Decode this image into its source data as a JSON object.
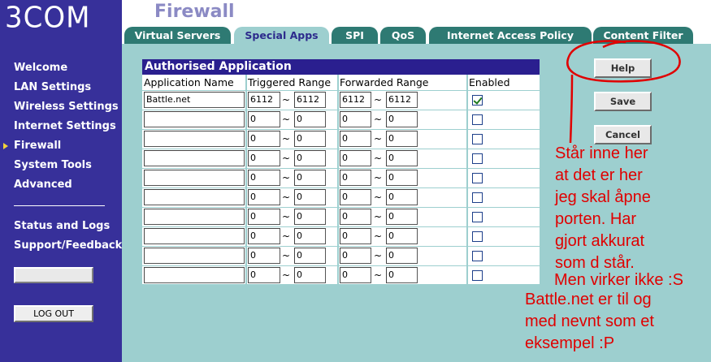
{
  "brand": {
    "logo": "3COM"
  },
  "sidebar": {
    "items": [
      {
        "label": "Welcome"
      },
      {
        "label": "LAN Settings"
      },
      {
        "label": "Wireless Settings"
      },
      {
        "label": "Internet Settings"
      },
      {
        "label": "Firewall",
        "active": true
      },
      {
        "label": "System Tools"
      },
      {
        "label": "Advanced"
      }
    ],
    "items2": [
      {
        "label": "Status and Logs"
      },
      {
        "label": "Support/Feedback"
      }
    ],
    "logout_label": "LOG OUT"
  },
  "header": {
    "title": "Firewall",
    "tabs": [
      {
        "label": "Virtual Servers"
      },
      {
        "label": "Special Apps",
        "active": true
      },
      {
        "label": "SPI"
      },
      {
        "label": "QoS"
      },
      {
        "label": "Internet Access Policy"
      },
      {
        "label": "Content Filter"
      }
    ]
  },
  "table": {
    "title": "Authorised Application",
    "columns": [
      "Application Name",
      "Triggered Range",
      "Forwarded Range",
      "Enabled"
    ],
    "separator": "~",
    "rows": [
      {
        "name": "Battle.net",
        "trig_from": "6112",
        "trig_to": "6112",
        "fwd_from": "6112",
        "fwd_to": "6112",
        "enabled": true
      },
      {
        "name": "",
        "trig_from": "0",
        "trig_to": "0",
        "fwd_from": "0",
        "fwd_to": "0",
        "enabled": false
      },
      {
        "name": "",
        "trig_from": "0",
        "trig_to": "0",
        "fwd_from": "0",
        "fwd_to": "0",
        "enabled": false
      },
      {
        "name": "",
        "trig_from": "0",
        "trig_to": "0",
        "fwd_from": "0",
        "fwd_to": "0",
        "enabled": false
      },
      {
        "name": "",
        "trig_from": "0",
        "trig_to": "0",
        "fwd_from": "0",
        "fwd_to": "0",
        "enabled": false
      },
      {
        "name": "",
        "trig_from": "0",
        "trig_to": "0",
        "fwd_from": "0",
        "fwd_to": "0",
        "enabled": false
      },
      {
        "name": "",
        "trig_from": "0",
        "trig_to": "0",
        "fwd_from": "0",
        "fwd_to": "0",
        "enabled": false
      },
      {
        "name": "",
        "trig_from": "0",
        "trig_to": "0",
        "fwd_from": "0",
        "fwd_to": "0",
        "enabled": false
      },
      {
        "name": "",
        "trig_from": "0",
        "trig_to": "0",
        "fwd_from": "0",
        "fwd_to": "0",
        "enabled": false
      },
      {
        "name": "",
        "trig_from": "0",
        "trig_to": "0",
        "fwd_from": "0",
        "fwd_to": "0",
        "enabled": false
      }
    ]
  },
  "buttons": {
    "help": "Help",
    "save": "Save",
    "cancel": "Cancel"
  },
  "annotation": {
    "color": "#e00000",
    "text1": "Står inne her\nat det er her\njeg skal åpne\nporten. Har\ngjort akkurat\nsom d står.",
    "text2": "Men virker ikke :S",
    "text3": "Battle.net er til og\nmed nevnt som et\neksempel :P"
  }
}
